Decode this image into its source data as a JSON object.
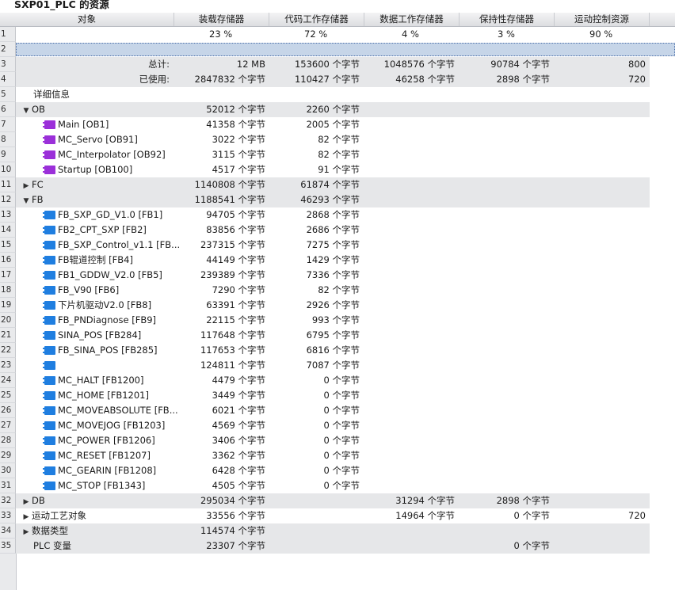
{
  "title": "SXP01_PLC 的资源",
  "columns": [
    "对象",
    "装载存储器",
    "代码工作存储器",
    "数据工作存储器",
    "保持性存储器",
    "运动控制资源"
  ],
  "rows": [
    {
      "n": "1",
      "obj": "",
      "load": "23 %",
      "code": "72 %",
      "data": "4 %",
      "ret": "3 %",
      "mot": "90 %",
      "pct": true
    },
    {
      "n": "2",
      "obj": "",
      "selected": true
    },
    {
      "n": "3",
      "obj": "总计:",
      "label": true,
      "load": "12 MB",
      "code": "153600 个字节",
      "data": "1048576 个字节",
      "ret": "90784 个字节",
      "mot": "800",
      "stripe": true
    },
    {
      "n": "4",
      "obj": "已使用:",
      "label": true,
      "load": "2847832 个字节",
      "code": "110427 个字节",
      "data": "46258 个字节",
      "ret": "2898 个字节",
      "mot": "720",
      "stripe": true
    },
    {
      "n": "5",
      "obj": "详细信息",
      "indent": 1
    },
    {
      "n": "6",
      "obj": "OB",
      "arrow": "▼",
      "indent": 0,
      "load": "52012 个字节",
      "code": "2260 个字节",
      "stripe": true
    },
    {
      "n": "7",
      "obj": "Main [OB1]",
      "icon": "ob",
      "indent": 2,
      "load": "41358 个字节",
      "code": "2005 个字节"
    },
    {
      "n": "8",
      "obj": "MC_Servo [OB91]",
      "icon": "ob",
      "indent": 2,
      "load": "3022 个字节",
      "code": "82 个字节"
    },
    {
      "n": "9",
      "obj": "MC_Interpolator [OB92]",
      "icon": "ob",
      "indent": 2,
      "load": "3115 个字节",
      "code": "82 个字节"
    },
    {
      "n": "10",
      "obj": "Startup [OB100]",
      "icon": "ob",
      "indent": 2,
      "load": "4517 个字节",
      "code": "91 个字节"
    },
    {
      "n": "11",
      "obj": "FC",
      "arrow": "▶",
      "indent": 0,
      "load": "1140808 个字节",
      "code": "61874 个字节",
      "stripe": true
    },
    {
      "n": "12",
      "obj": "FB",
      "arrow": "▼",
      "indent": 0,
      "load": "1188541 个字节",
      "code": "46293 个字节",
      "stripe": true
    },
    {
      "n": "13",
      "obj": "FB_SXP_GD_V1.0 [FB1]",
      "icon": "fb",
      "indent": 2,
      "load": "94705 个字节",
      "code": "2868 个字节"
    },
    {
      "n": "14",
      "obj": "FB2_CPT_SXP [FB2]",
      "icon": "fb",
      "indent": 2,
      "load": "83856 个字节",
      "code": "2686 个字节"
    },
    {
      "n": "15",
      "obj": "FB_SXP_Control_v1.1 [FB...",
      "icon": "fb",
      "indent": 2,
      "load": "237315 个字节",
      "code": "7275 个字节"
    },
    {
      "n": "16",
      "obj": "FB辊道控制 [FB4]",
      "icon": "fb",
      "indent": 2,
      "load": "44149 个字节",
      "code": "1429 个字节"
    },
    {
      "n": "17",
      "obj": "FB1_GDDW_V2.0 [FB5]",
      "icon": "fb",
      "indent": 2,
      "load": "239389 个字节",
      "code": "7336 个字节"
    },
    {
      "n": "18",
      "obj": "FB_V90 [FB6]",
      "icon": "fb",
      "indent": 2,
      "load": "7290 个字节",
      "code": "82 个字节"
    },
    {
      "n": "19",
      "obj": "下片机驱动V2.0 [FB8]",
      "icon": "fb",
      "indent": 2,
      "load": "63391 个字节",
      "code": "2926 个字节"
    },
    {
      "n": "20",
      "obj": "FB_PNDiagnose [FB9]",
      "icon": "fb",
      "indent": 2,
      "load": "22115 个字节",
      "code": "993 个字节"
    },
    {
      "n": "21",
      "obj": "SINA_POS [FB284]",
      "icon": "fb",
      "indent": 2,
      "load": "117648 个字节",
      "code": "6795 个字节"
    },
    {
      "n": "22",
      "obj": "FB_SINA_POS [FB285]",
      "icon": "fb",
      "indent": 2,
      "load": "117653 个字节",
      "code": "6816 个字节"
    },
    {
      "n": "23",
      "obj": "",
      "icon": "fb",
      "indent": 2,
      "load": "124811 个字节",
      "code": "7087 个字节"
    },
    {
      "n": "24",
      "obj": "MC_HALT [FB1200]",
      "icon": "fb",
      "indent": 2,
      "load": "4479 个字节",
      "code": "0 个字节"
    },
    {
      "n": "25",
      "obj": "MC_HOME [FB1201]",
      "icon": "fb",
      "indent": 2,
      "load": "3449 个字节",
      "code": "0 个字节"
    },
    {
      "n": "26",
      "obj": "MC_MOVEABSOLUTE [FB...",
      "icon": "fb",
      "indent": 2,
      "load": "6021 个字节",
      "code": "0 个字节"
    },
    {
      "n": "27",
      "obj": "MC_MOVEJOG [FB1203]",
      "icon": "fb",
      "indent": 2,
      "load": "4569 个字节",
      "code": "0 个字节"
    },
    {
      "n": "28",
      "obj": "MC_POWER [FB1206]",
      "icon": "fb",
      "indent": 2,
      "load": "3406 个字节",
      "code": "0 个字节"
    },
    {
      "n": "29",
      "obj": "MC_RESET [FB1207]",
      "icon": "fb",
      "indent": 2,
      "load": "3362 个字节",
      "code": "0 个字节"
    },
    {
      "n": "30",
      "obj": "MC_GEARIN [FB1208]",
      "icon": "fb",
      "indent": 2,
      "load": "6428 个字节",
      "code": "0 个字节"
    },
    {
      "n": "31",
      "obj": "MC_STOP [FB1343]",
      "icon": "fb",
      "indent": 2,
      "load": "4505 个字节",
      "code": "0 个字节"
    },
    {
      "n": "32",
      "obj": "DB",
      "arrow": "▶",
      "indent": 0,
      "load": "295034 个字节",
      "data": "31294 个字节",
      "ret": "2898 个字节",
      "stripe": true
    },
    {
      "n": "33",
      "obj": "运动工艺对象",
      "arrow": "▶",
      "indent": 0,
      "load": "33556 个字节",
      "data": "14964 个字节",
      "ret": "0 个字节",
      "mot": "720"
    },
    {
      "n": "34",
      "obj": "数据类型",
      "arrow": "▶",
      "indent": 0,
      "load": "114574 个字节",
      "stripe": true
    },
    {
      "n": "35",
      "obj": "PLC 变量",
      "indent": 1,
      "load": "23307 个字节",
      "ret": "0 个字节",
      "stripe": true
    }
  ]
}
